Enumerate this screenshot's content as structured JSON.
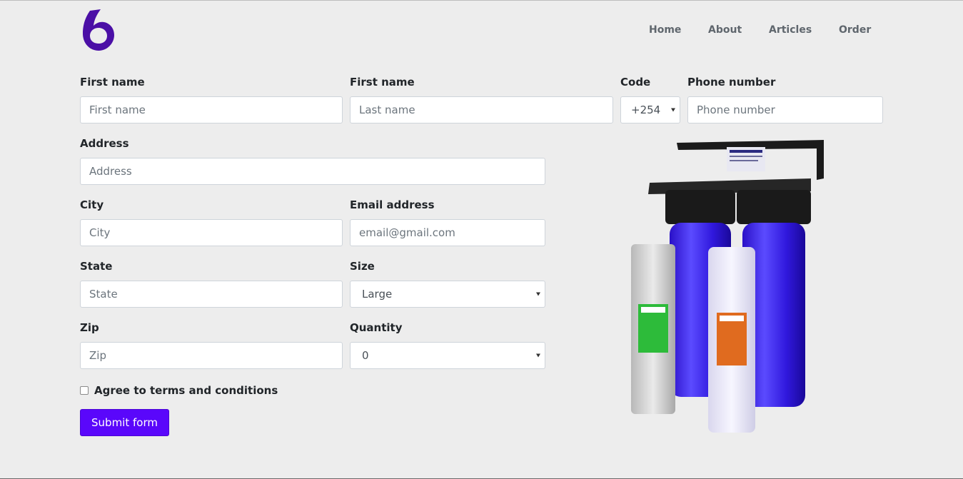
{
  "brand": {
    "logo_icon": "water-drop-six-icon",
    "color": "#4b0fa6"
  },
  "nav": {
    "items": [
      {
        "label": "Home"
      },
      {
        "label": "About"
      },
      {
        "label": "Articles"
      },
      {
        "label": "Order"
      }
    ]
  },
  "form": {
    "first_name": {
      "label": "First name",
      "placeholder": "First name"
    },
    "last_name": {
      "label": "First name",
      "placeholder": "Last name"
    },
    "code": {
      "label": "Code",
      "value": "+254"
    },
    "phone": {
      "label": "Phone number",
      "placeholder": "Phone number"
    },
    "address": {
      "label": "Address",
      "placeholder": "Address"
    },
    "city": {
      "label": "City",
      "placeholder": "City"
    },
    "email": {
      "label": "Email address",
      "placeholder": "email@gmail.com"
    },
    "state": {
      "label": "State",
      "placeholder": "State"
    },
    "size": {
      "label": "Size",
      "value": "Large"
    },
    "zip": {
      "label": "Zip",
      "placeholder": "Zip"
    },
    "quantity": {
      "label": "Quantity",
      "value": "0"
    },
    "terms": {
      "label": "Agree to terms and conditions",
      "checked": false
    },
    "submit": {
      "label": "Submit form"
    }
  },
  "product_image": {
    "icon": "water-filter-system-image",
    "accent": "#2a14d6"
  }
}
